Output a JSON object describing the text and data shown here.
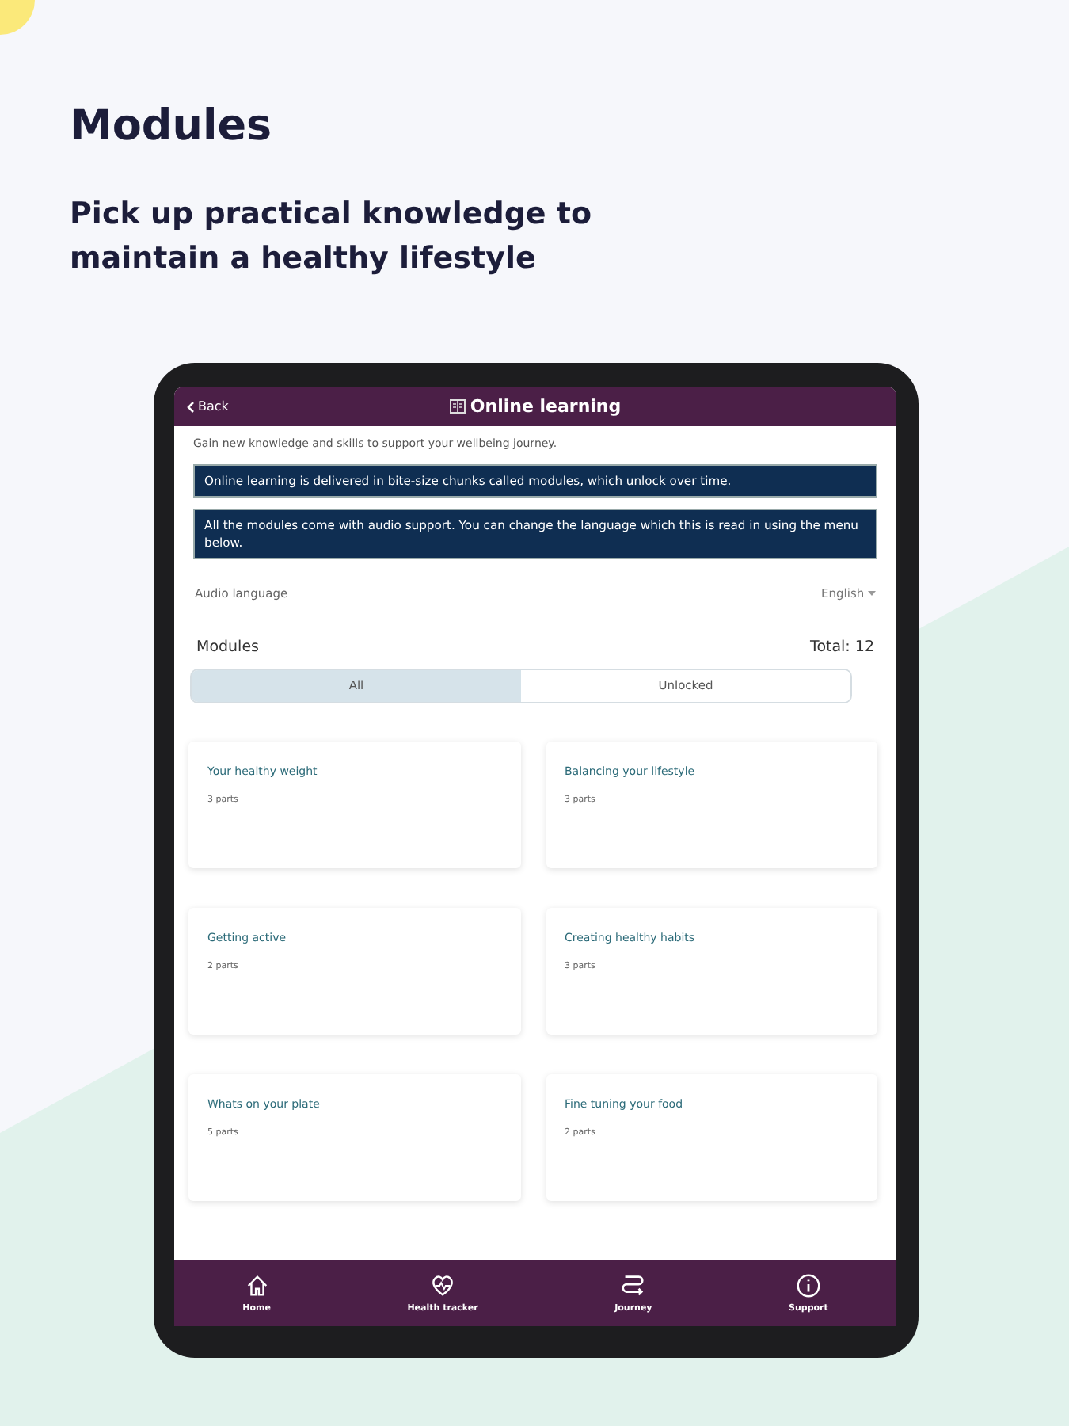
{
  "heading": "Modules",
  "subheading": "Pick up practical knowledge to maintain a healthy lifestyle",
  "app": {
    "back": "Back",
    "title": "Online learning",
    "intro": "Gain new knowledge and skills to support your wellbeing journey.",
    "notices": [
      "Online learning is delivered in bite-size chunks called modules, which unlock over time.",
      "All the modules come with audio support. You can change the language which this is read in using the menu below."
    ],
    "audio_language": {
      "label": "Audio language",
      "value": "English"
    },
    "modules_title": "Modules",
    "total": "Total: 12",
    "tabs": [
      {
        "label": "All",
        "selected": true
      },
      {
        "label": "Unlocked",
        "selected": false
      }
    ],
    "modules": [
      {
        "title": "Your healthy weight",
        "parts": "3 parts"
      },
      {
        "title": "Balancing your lifestyle",
        "parts": "3 parts"
      },
      {
        "title": "Getting active",
        "parts": "2 parts"
      },
      {
        "title": "Creating healthy habits",
        "parts": "3 parts"
      },
      {
        "title": "Whats on your plate",
        "parts": "5 parts"
      },
      {
        "title": "Fine tuning your food",
        "parts": "2 parts"
      }
    ],
    "nav": [
      {
        "label": "Home",
        "kind": "home"
      },
      {
        "label": "Health tracker",
        "kind": "heart"
      },
      {
        "label": "Journey",
        "kind": "journey"
      },
      {
        "label": "Support",
        "kind": "support"
      }
    ]
  }
}
